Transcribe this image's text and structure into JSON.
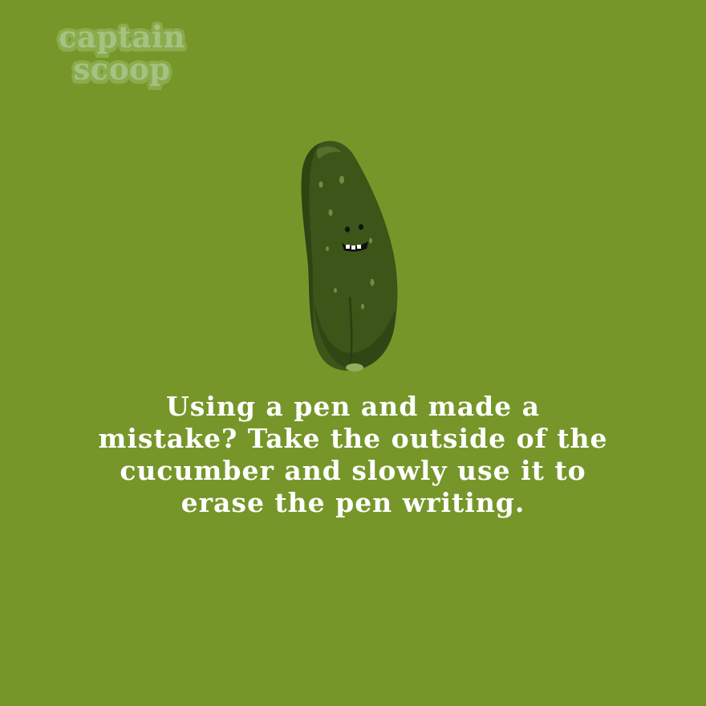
{
  "colors": {
    "background": "#77962a",
    "logo_text": "#a6c281",
    "logo_outline": "#8aac4d",
    "caption_text": "#ffffff",
    "cucumber_body": "#3c5519",
    "cucumber_highlight": "#8fb05c"
  },
  "logo": {
    "line1": "captain",
    "line2": "scoop"
  },
  "illustration": {
    "icon": "smiling-cucumber-icon"
  },
  "caption": {
    "lines": [
      "Using a pen and made a",
      "mistake? Take the outside of the",
      "cucumber and slowly use it to",
      "erase the pen writing."
    ]
  }
}
